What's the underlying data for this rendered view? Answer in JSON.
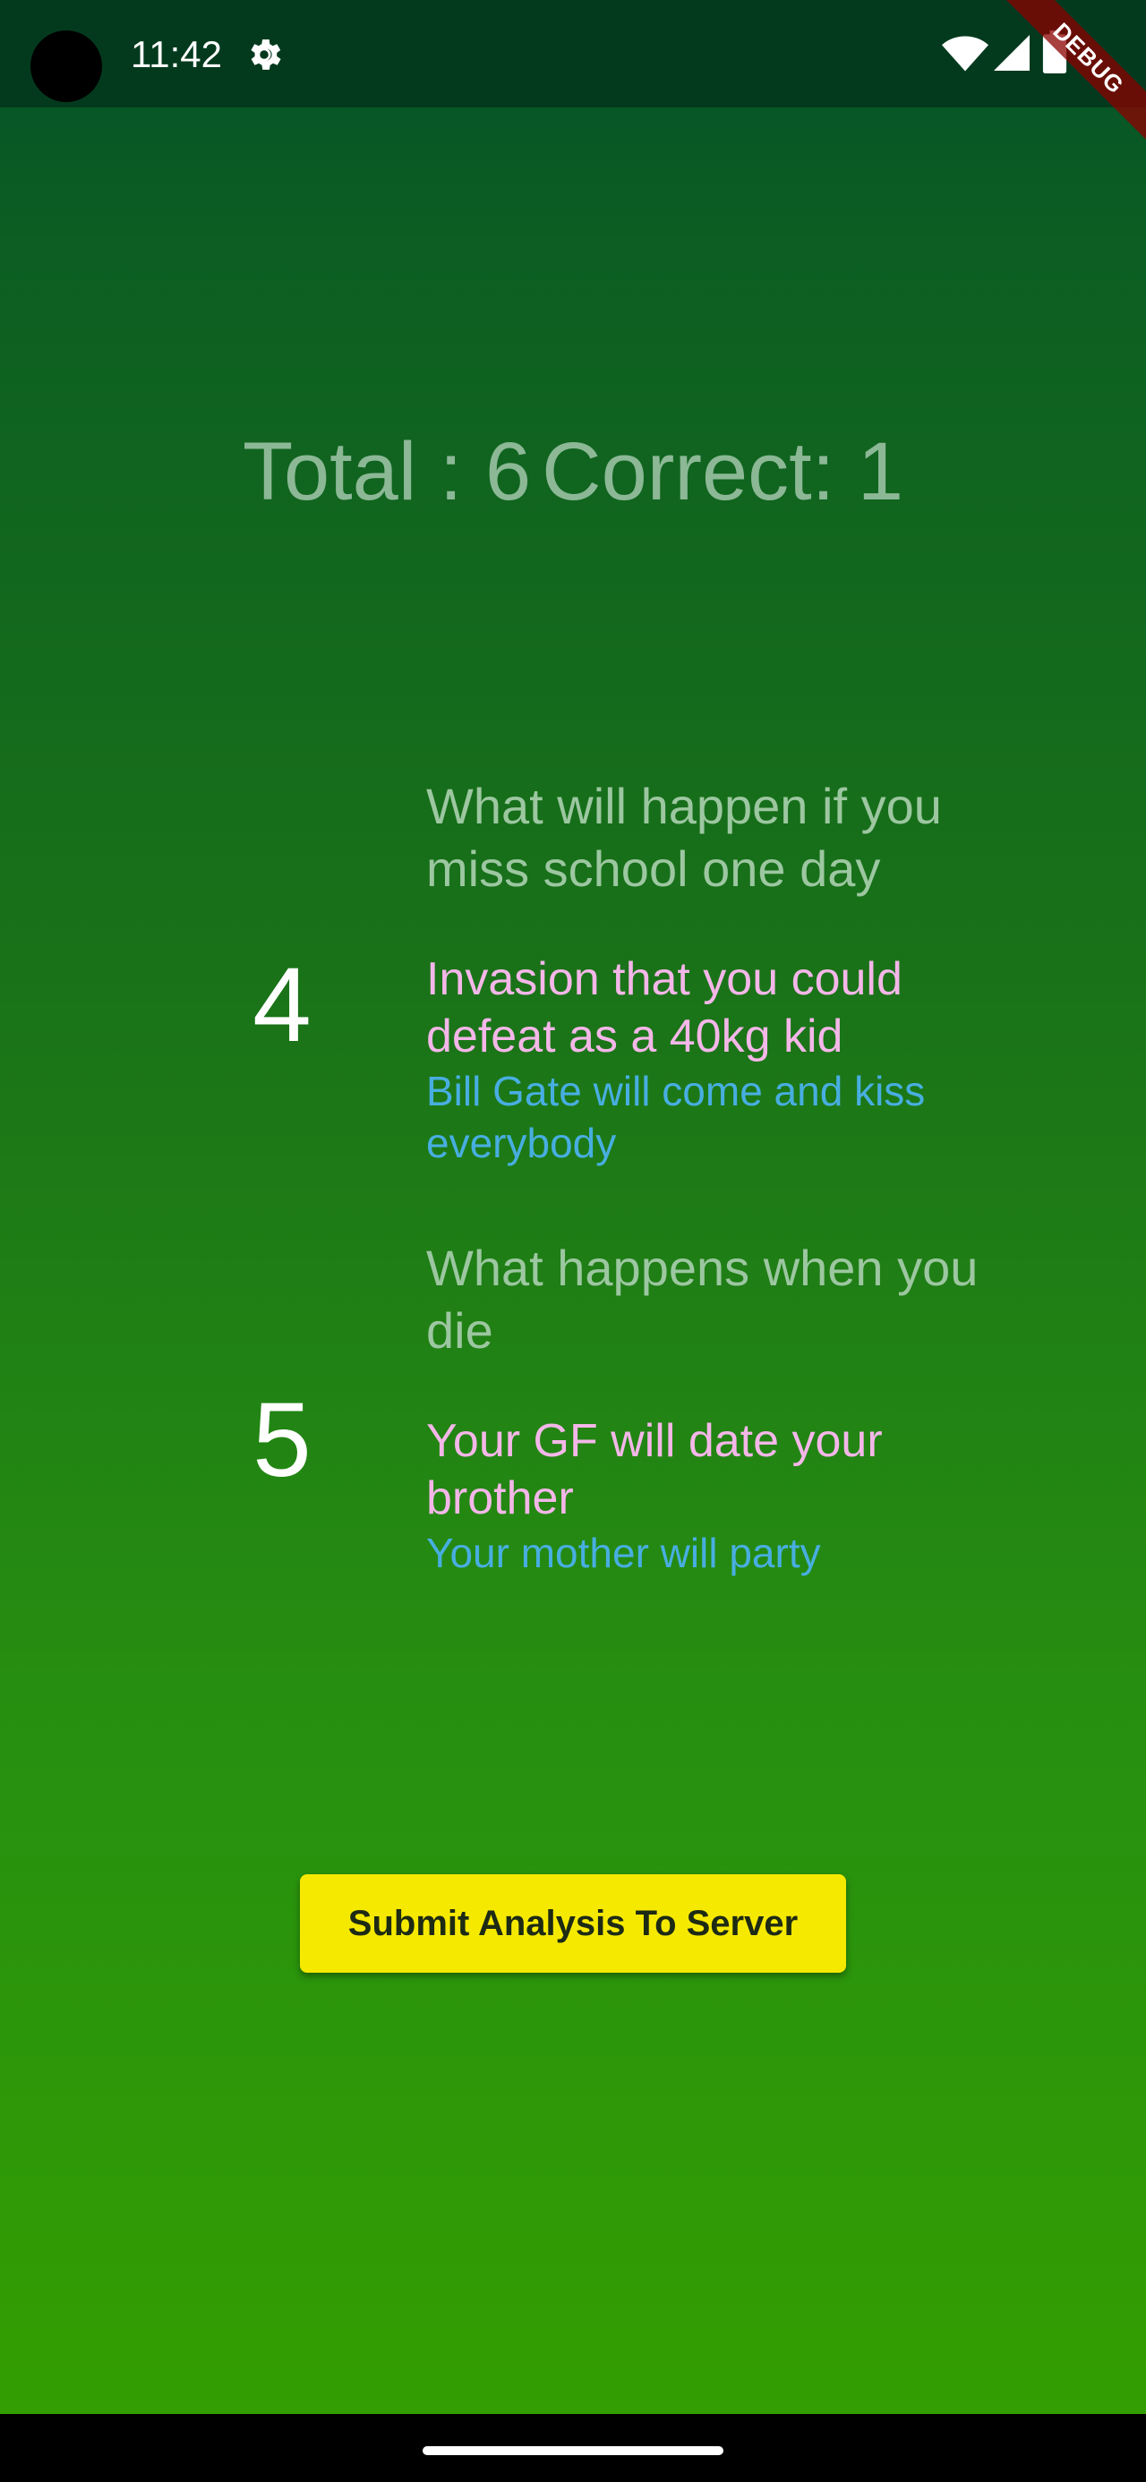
{
  "status_bar": {
    "time": "11:42"
  },
  "debug_banner": {
    "label": "DEBUG"
  },
  "score": {
    "total_label": "Total : 6",
    "correct_label": "Correct: 1"
  },
  "results": [
    {
      "number": "4",
      "question": "What will happen if you miss school one day",
      "user_answer": "Invasion that you could defeat as a 40kg kid",
      "correct_answer": "Bill Gate will come and kiss everybody"
    },
    {
      "number": "5",
      "question": "What happens when you die",
      "user_answer": "Your GF will date your brother",
      "correct_answer": "Your mother will party"
    }
  ],
  "submit_button": {
    "label": "Submit Analysis To Server"
  },
  "colors": {
    "background_top": "#04512a",
    "background_bottom": "#349f00",
    "question": "#9cc7a0",
    "user_answer": "#f4b7e8",
    "correct_answer": "#48aee0",
    "button": "#f6e900"
  },
  "icons": [
    "gear-icon",
    "wifi-icon",
    "signal-icon",
    "battery-icon"
  ]
}
